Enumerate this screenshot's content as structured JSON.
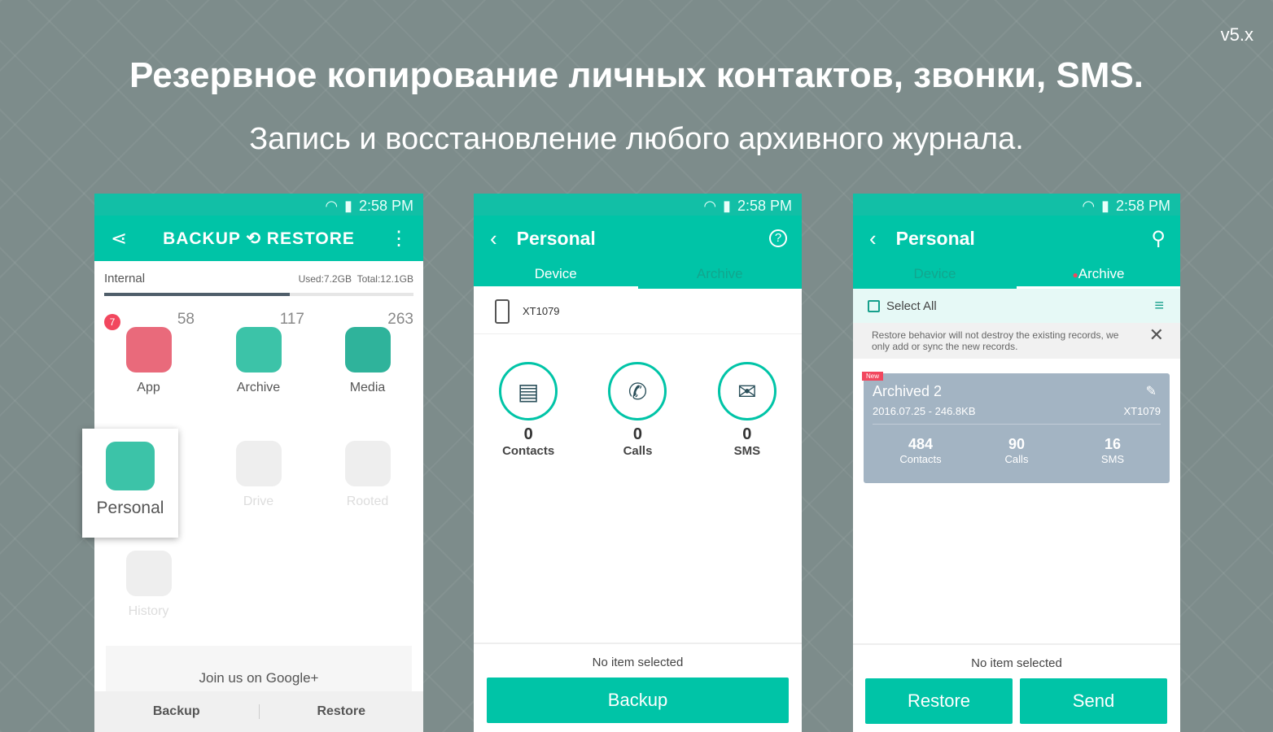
{
  "version": "v5.x",
  "headline": "Резервное копирование личных контактов, звонки, SMS.",
  "subheadline": "Запись и восстановление любого архивного журнала.",
  "status_time": "2:58 PM",
  "colors": {
    "accent": "#00c4a7",
    "badge": "#f2475e"
  },
  "screen1": {
    "title": "BACKUP ⟲ RESTORE",
    "storage_label": "Internal",
    "used": "Used:7.2GB",
    "total": "Total:12.1GB",
    "used_fraction": 0.6,
    "tiles": [
      {
        "label": "App",
        "count": "58",
        "badge": "7"
      },
      {
        "label": "Archive",
        "count": "117"
      },
      {
        "label": "Media",
        "count": "263"
      },
      {
        "label": "Personal"
      },
      {
        "label": "Drive"
      },
      {
        "label": "Rooted"
      },
      {
        "label": "History"
      }
    ],
    "google": "Join us on Google+",
    "backup": "Backup",
    "restore": "Restore"
  },
  "screen2": {
    "title": "Personal",
    "tabs": [
      "Device",
      "Archive"
    ],
    "device": "XT1079",
    "stats": [
      {
        "value": "0",
        "label": "Contacts"
      },
      {
        "value": "0",
        "label": "Calls"
      },
      {
        "value": "0",
        "label": "SMS"
      }
    ],
    "status": "No item selected",
    "backup": "Backup"
  },
  "screen3": {
    "title": "Personal",
    "tabs": [
      "Device",
      "Archive"
    ],
    "select_all": "Select All",
    "notice": "Restore behavior will not destroy the existing records, we only add or sync the new records.",
    "card": {
      "badge": "New",
      "name": "Archived 2",
      "meta": "2016.07.25 - 246.8KB",
      "device": "XT1079",
      "stats": [
        {
          "value": "484",
          "label": "Contacts"
        },
        {
          "value": "90",
          "label": "Calls"
        },
        {
          "value": "16",
          "label": "SMS"
        }
      ]
    },
    "status": "No item selected",
    "restore": "Restore",
    "send": "Send"
  }
}
